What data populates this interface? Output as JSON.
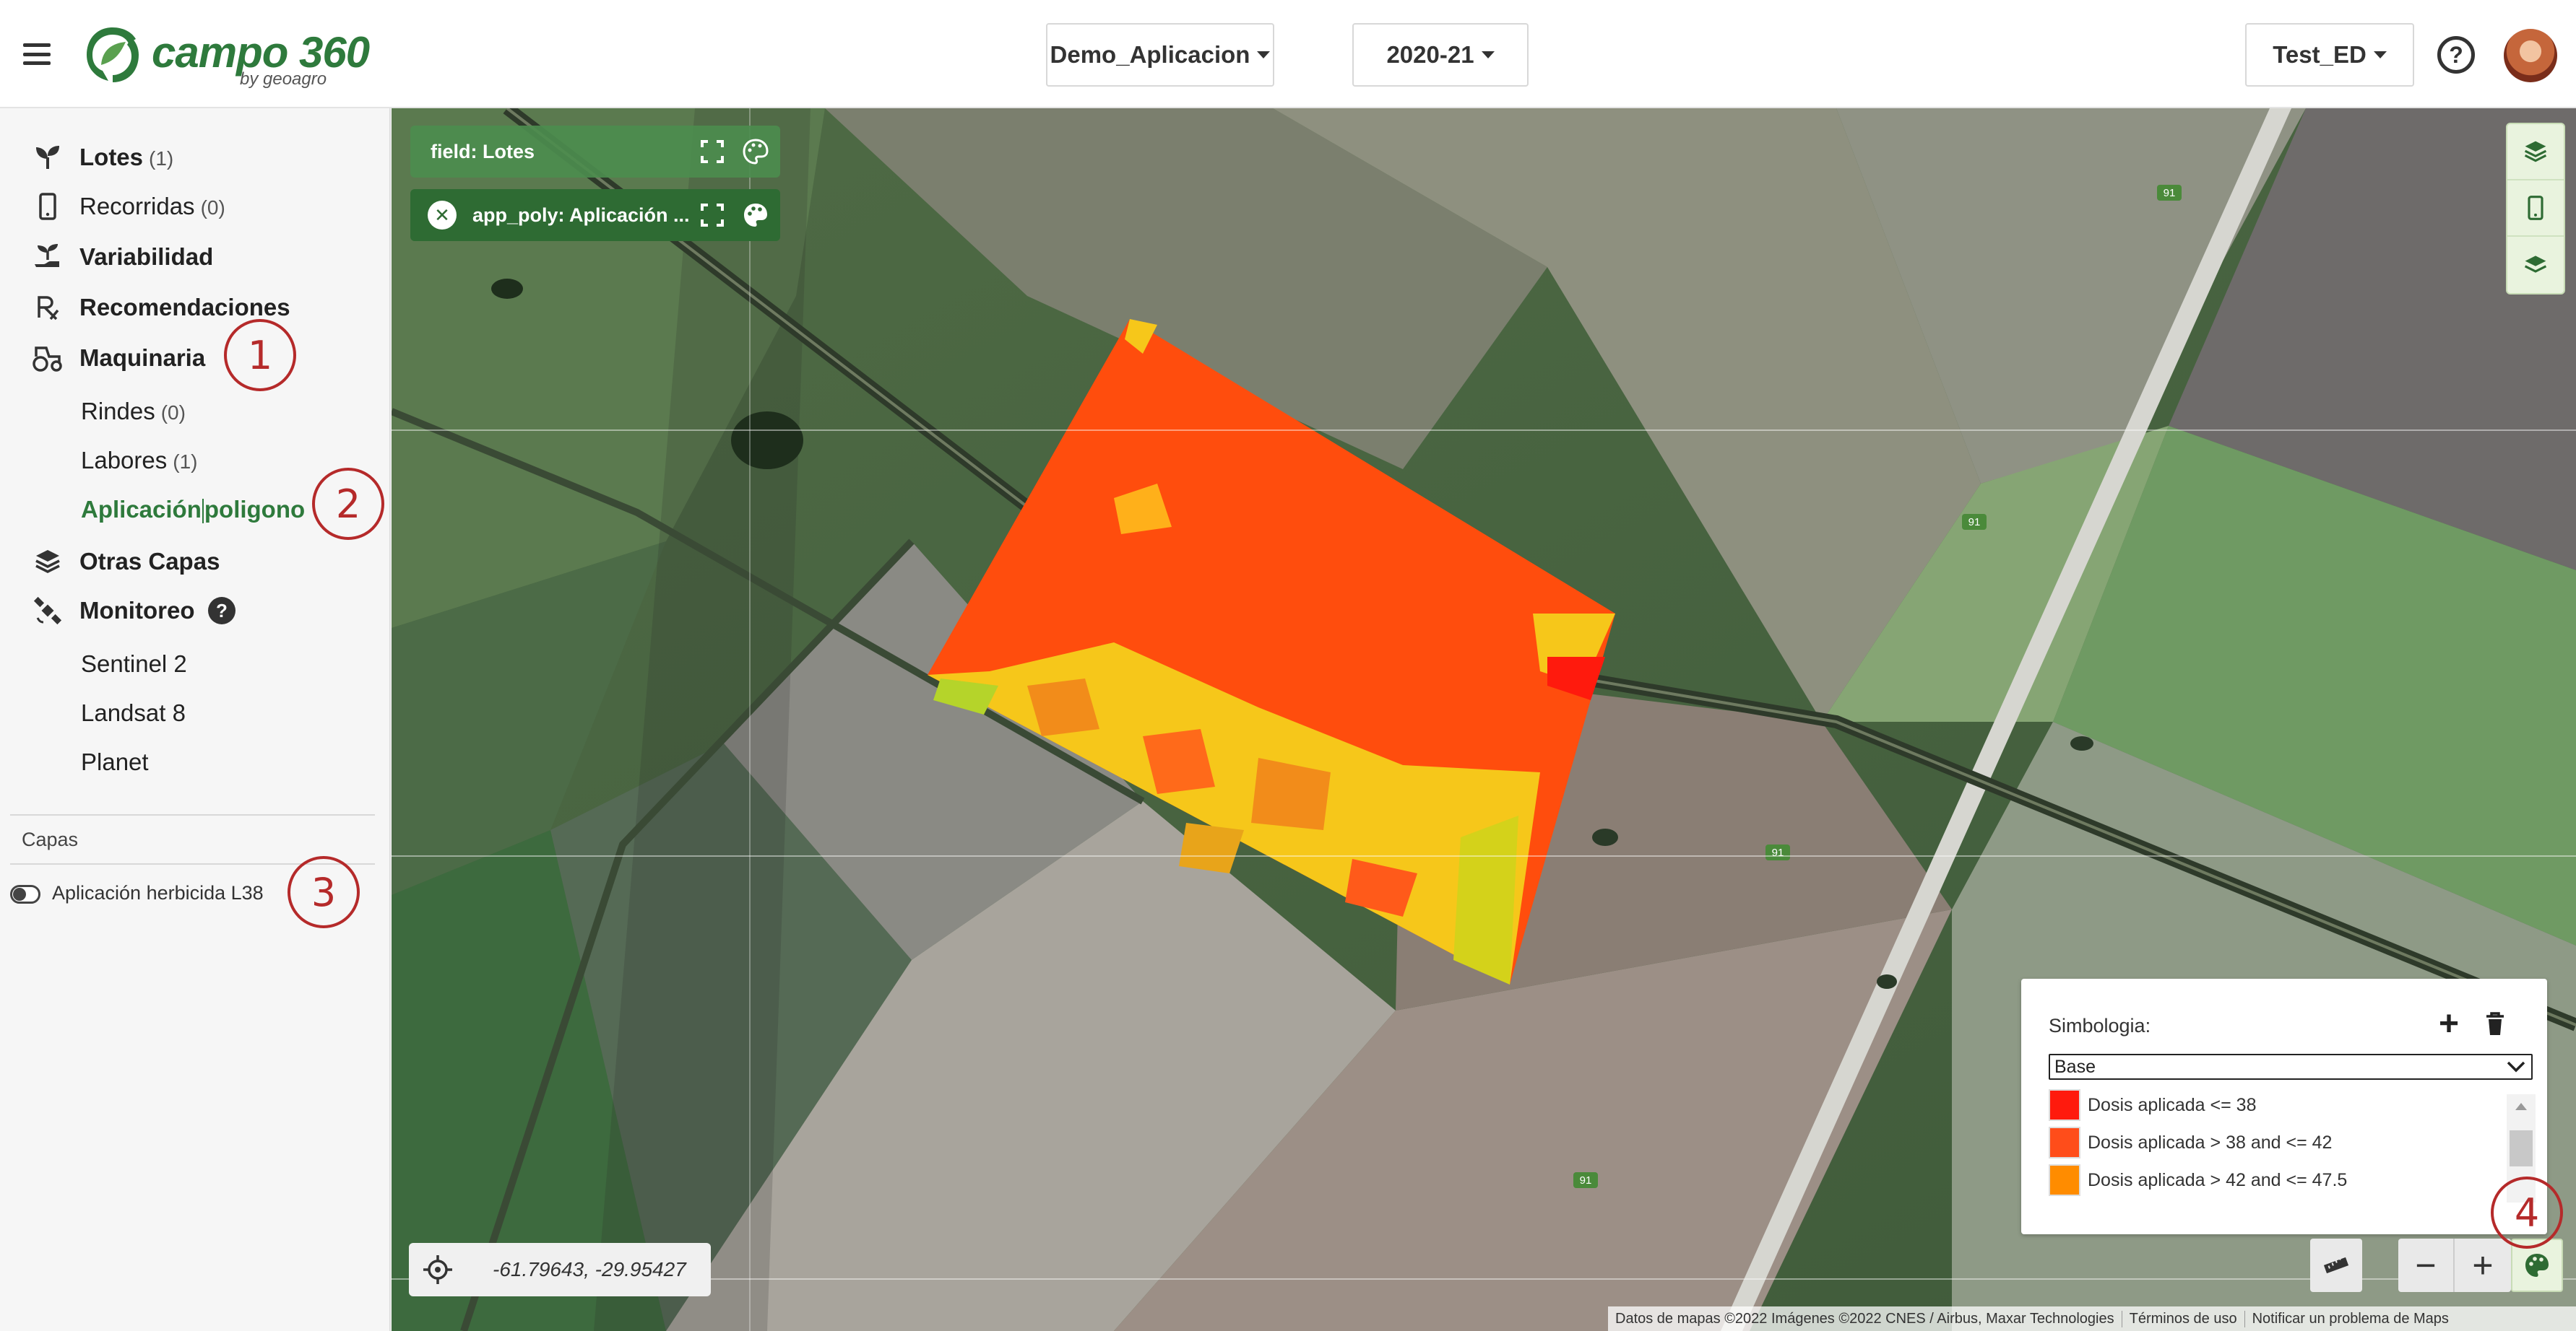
{
  "header": {
    "menu_icon": "hamburger-icon",
    "logo": {
      "name": "campo 360",
      "subtitle": "by geoagro"
    },
    "dataset_dropdown": "Demo_Aplicacion",
    "season_dropdown": "2020-21",
    "user_dropdown": "Test_ED",
    "help_icon": "?"
  },
  "sidebar": {
    "items": [
      {
        "label": "Lotes",
        "count": "(1)",
        "icon": "sprout-icon"
      },
      {
        "label": "Recorridas",
        "count": "(0)",
        "icon": "phone-icon"
      },
      {
        "label": "Variabilidad",
        "count": "",
        "icon": "plant-hand-icon"
      },
      {
        "label": "Recomendaciones",
        "count": "",
        "icon": "prescription-icon"
      },
      {
        "label": "Maquinaria",
        "count": "",
        "icon": "tractor-icon"
      }
    ],
    "maquinaria_sub": [
      {
        "label": "Rindes",
        "count": "(0)"
      },
      {
        "label": "Labores",
        "count": "(1)"
      },
      {
        "label_a": "Aplicación",
        "label_b": "poligono",
        "active": true
      }
    ],
    "otras_capas": {
      "label": "Otras Capas",
      "icon": "layers-icon"
    },
    "monitoreo": {
      "label": "Monitoreo",
      "icon": "satellite-icon",
      "help": "?"
    },
    "monitoreo_sub": [
      "Sentinel 2",
      "Landsat 8",
      "Planet"
    ],
    "capas_title": "Capas",
    "capas_layer": "Aplicación herbicida L38"
  },
  "callouts": [
    "1",
    "2",
    "3",
    "4"
  ],
  "map": {
    "layer_cards": [
      {
        "label": "field: Lotes"
      },
      {
        "label": "app_poly: Aplicación ..."
      }
    ],
    "road_label": "91",
    "coordinates": "-61.79643, -29.95427",
    "legend": {
      "title": "Simbologia:",
      "add": "+",
      "select_value": "Base",
      "entries": [
        {
          "label": "Dosis aplicada <= 38",
          "color": "#ff1a0d"
        },
        {
          "label": "Dosis aplicada > 38 and <= 42",
          "color": "#ff4d1a"
        },
        {
          "label": "Dosis aplicada > 42 and <= 47.5",
          "color": "#ff8c00"
        }
      ]
    },
    "zoom_out": "−",
    "zoom_in": "+",
    "attribution": [
      "Datos de mapas ©2022 Imágenes ©2022 CNES / Airbus, Maxar Technologies",
      "Términos de uso",
      "Notificar un problema de Maps"
    ]
  },
  "colors": {
    "brand_green": "#2e7a3c",
    "callout_red": "#b52a2a"
  }
}
